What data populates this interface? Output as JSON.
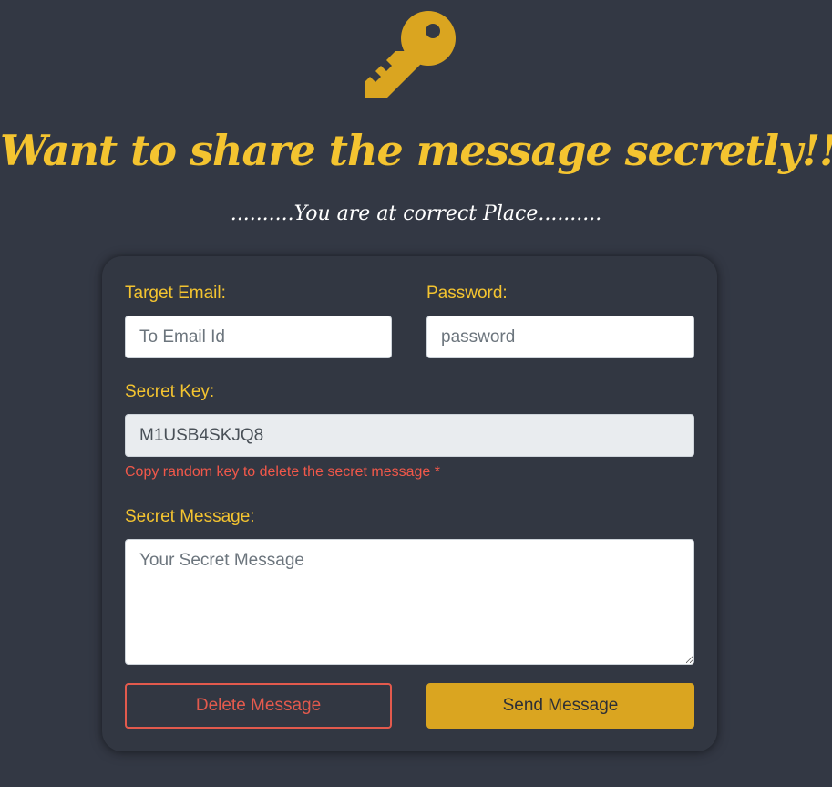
{
  "header": {
    "icon": "key-icon",
    "title": "Want to share the message secretly!!!",
    "subtitle": "..........You are at correct Place.........."
  },
  "form": {
    "target_email": {
      "label": "Target Email:",
      "placeholder": "To Email Id",
      "value": ""
    },
    "password": {
      "label": "Password:",
      "placeholder": "password",
      "value": ""
    },
    "secret_key": {
      "label": "Secret Key:",
      "value": "M1USB4SKJQ8",
      "hint": "Copy random key to delete the secret message *"
    },
    "secret_message": {
      "label": "Secret Message:",
      "placeholder": "Your Secret Message",
      "value": ""
    },
    "delete_button": "Delete Message",
    "send_button": "Send Message"
  },
  "colors": {
    "background": "#333844",
    "accent": "#f4c430",
    "key_icon": "#daa520",
    "danger": "#e35a4d",
    "send_button": "#daa520"
  }
}
